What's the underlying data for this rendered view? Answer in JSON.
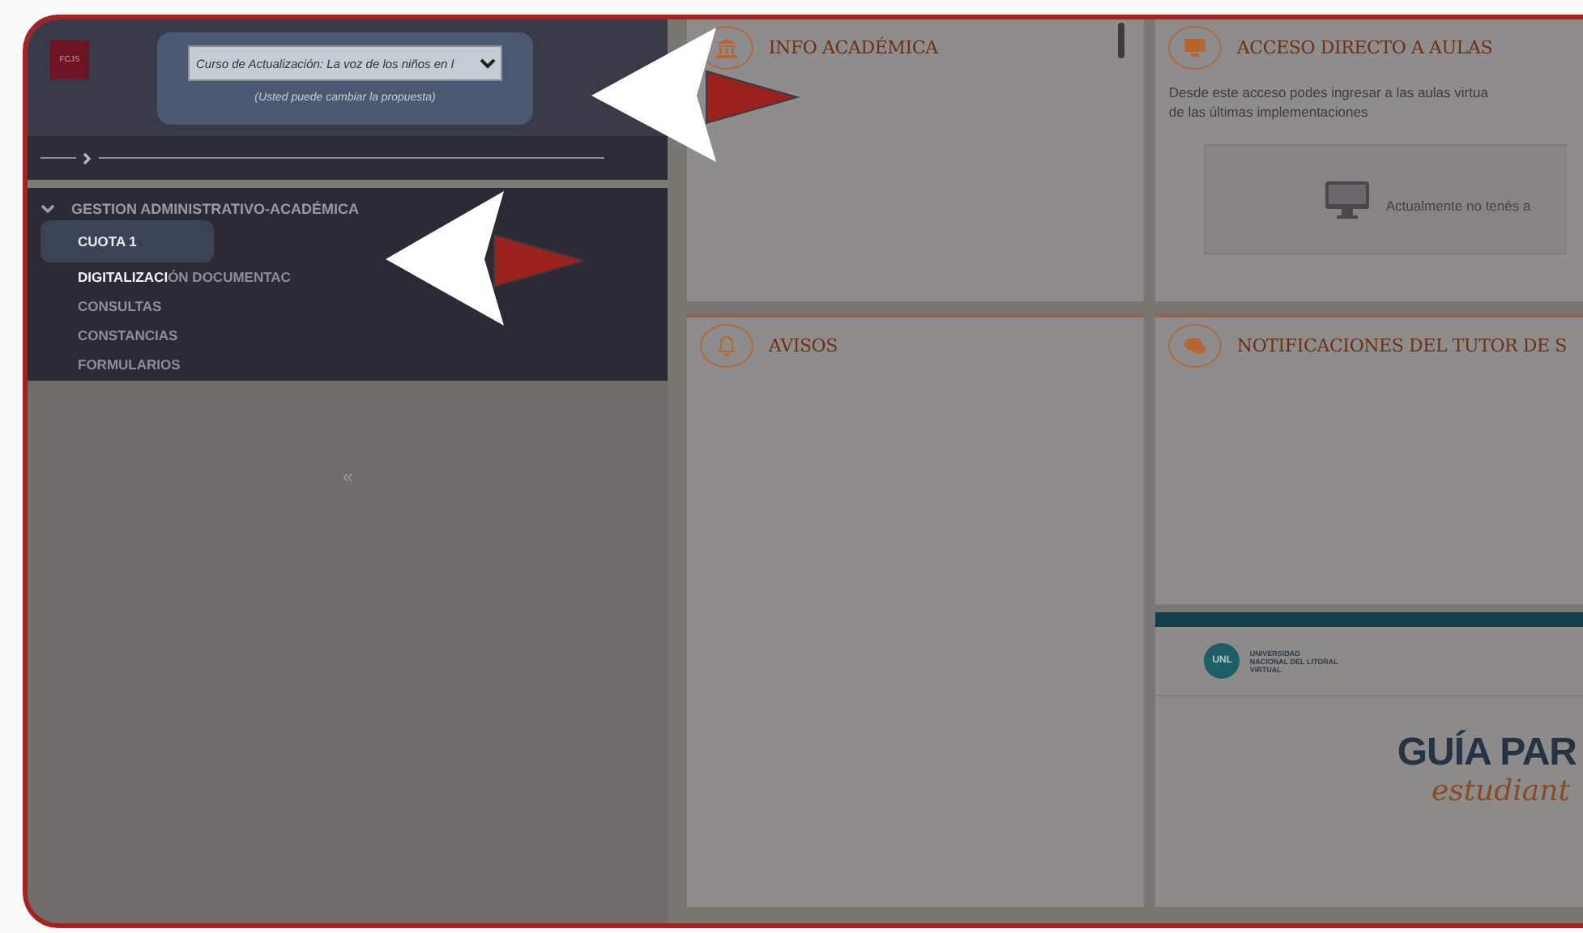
{
  "sidebar": {
    "logo": "FCJS",
    "proposal_select": {
      "value": "Curso de Actualización: La voz de los niños en l"
    },
    "proposal_hint": "(Usted puede cambiar la propuesta)",
    "menu": {
      "title": "GESTION ADMINISTRATIVO-ACADÉMICA",
      "expanded": true,
      "items": [
        {
          "label": "CUOTA 1",
          "selected": true
        },
        {
          "label": "**DIGITALIZACI**ÓN DOCUMENTAC",
          "selected": false
        },
        {
          "label": "CONSULTAS",
          "selected": false
        },
        {
          "label": "CONSTANCIAS",
          "selected": false
        },
        {
          "label": "FORMULARIOS",
          "selected": false
        }
      ]
    },
    "collapse": "«"
  },
  "cards": [
    {
      "kind": "info",
      "title": "INFO ACADÉMICA"
    },
    {
      "kind": "access",
      "title": "ACCESO DIRECTO A AULAS",
      "description": [
        "Desde este acceso podes ingresar a las aulas virtua",
        "de las últimas implementaciones"
      ],
      "empty_message": "Actualmente no tenés a"
    },
    {
      "kind": "notices",
      "title": "AVISOS"
    },
    {
      "kind": "tutor",
      "title": "NOTIFICACIONES DEL TUTOR DE S"
    }
  ],
  "guide": {
    "brand": "UNL",
    "brand_name": [
      "UNIVERSIDAD",
      "NACIONAL DEL LITORAL",
      "VIRTUAL"
    ],
    "heading": "GUÍA PAR",
    "script": "estudiant"
  }
}
